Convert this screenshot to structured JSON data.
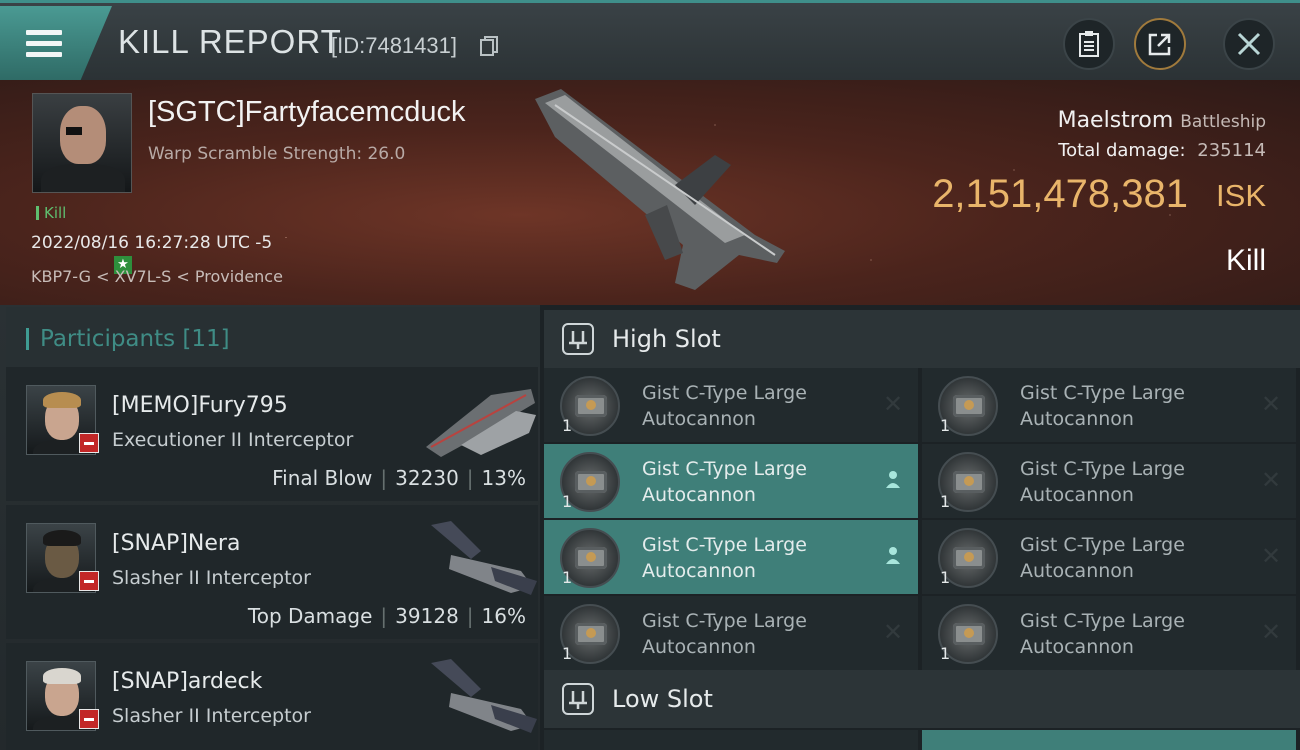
{
  "header": {
    "title": "KILL REPORT",
    "report_id": "[ID:7481431]",
    "icons": {
      "menu": "menu-icon",
      "copy": "copy-icon",
      "clipboard": "clipboard-icon",
      "share": "share-icon",
      "close": "close-icon"
    }
  },
  "victim": {
    "name": "[SGTC]Fartyfacemcduck",
    "warp_scramble": "Warp Scramble Strength: 26.0",
    "tag": "Kill",
    "datetime": "2022/08/16 16:27:28 UTC -5",
    "location": "KBP7-G < XV7L-S < Providence",
    "ship_name": "Maelstrom",
    "ship_class": "Battleship",
    "total_damage_label": "Total damage:",
    "total_damage": "235114",
    "isk_value": "2,151,478,381",
    "isk_unit": "ISK",
    "result": "Kill"
  },
  "participants": {
    "title": "Participants [11]",
    "items": [
      {
        "name": "[MEMO]Fury795",
        "ship": "Executioner II Interceptor",
        "label": "Final Blow",
        "damage": "32230",
        "percent": "13%",
        "hair": "#b78d50"
      },
      {
        "name": "[SNAP]Nera",
        "ship": "Slasher II Interceptor",
        "label": "Top Damage",
        "damage": "39128",
        "percent": "16%",
        "hair": "#1a1a1a"
      },
      {
        "name": "[SNAP]ardeck",
        "ship": "Slasher II Interceptor",
        "label": "",
        "damage": "",
        "percent": "",
        "hair": "#d9d6cf"
      }
    ]
  },
  "slots": {
    "high": {
      "title": "High Slot",
      "modules": [
        {
          "line1": "Gist C-Type Large",
          "line2": "Autocannon",
          "qty": "1",
          "active": false
        },
        {
          "line1": "Gist C-Type Large",
          "line2": "Autocannon",
          "qty": "1",
          "active": false
        },
        {
          "line1": "Gist C-Type Large",
          "line2": "Autocannon",
          "qty": "1",
          "active": true
        },
        {
          "line1": "Gist C-Type Large",
          "line2": "Autocannon",
          "qty": "1",
          "active": false
        },
        {
          "line1": "Gist C-Type Large",
          "line2": "Autocannon",
          "qty": "1",
          "active": true
        },
        {
          "line1": "Gist C-Type Large",
          "line2": "Autocannon",
          "qty": "1",
          "active": false
        },
        {
          "line1": "Gist C-Type Large",
          "line2": "Autocannon",
          "qty": "1",
          "active": false
        },
        {
          "line1": "Gist C-Type Large",
          "line2": "Autocannon",
          "qty": "1",
          "active": false
        }
      ]
    },
    "low": {
      "title": "Low Slot"
    }
  },
  "colors": {
    "accent": "#3f9c93",
    "isk": "#e9b56a",
    "danger": "#c22727",
    "kill_green": "#5fbf6f"
  }
}
